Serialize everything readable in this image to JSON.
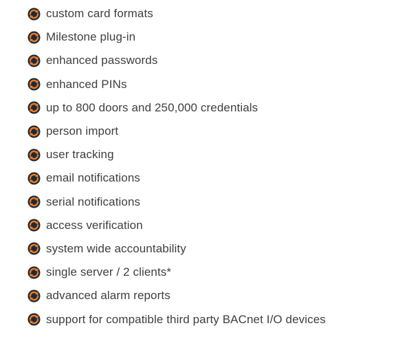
{
  "bullet_colors": {
    "orange": "#f07a1e",
    "navy": "#1d2a3a"
  },
  "bullet_icon": "orange-navy-refresh-icon",
  "features": [
    "custom card formats",
    "Milestone plug-in",
    "enhanced passwords",
    "enhanced PINs",
    "up to 800 doors and 250,000 credentials",
    "person import",
    "user tracking",
    "email notifications",
    "serial notifications",
    "access verification",
    "system wide accountability",
    "single server / 2 clients*",
    "advanced alarm reports",
    "support for compatible third party BACnet I/O devices"
  ]
}
